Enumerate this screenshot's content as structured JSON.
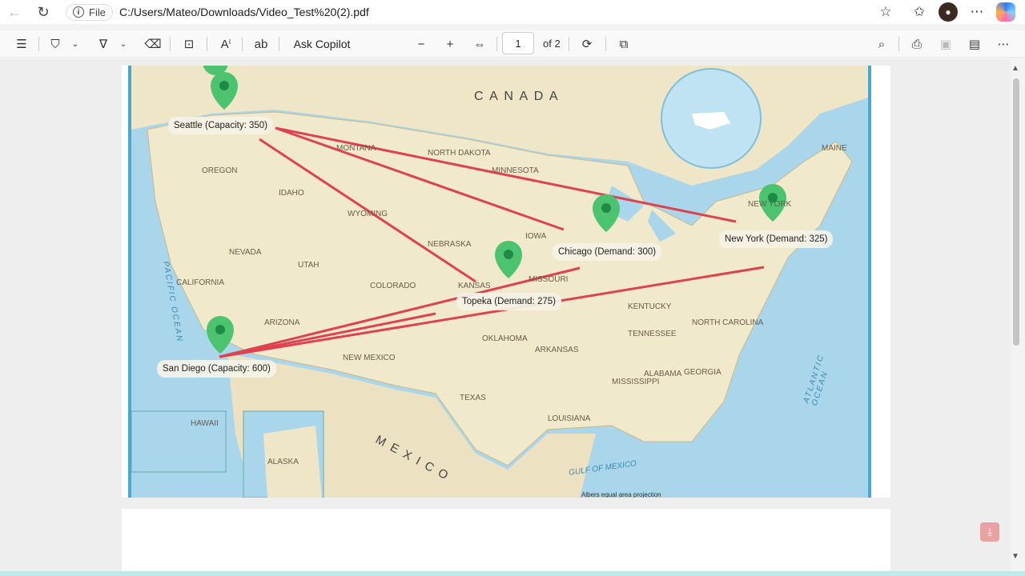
{
  "browser": {
    "file_chip": "File",
    "address": "C:/Users/Mateo/Downloads/Video_Test%20(2).pdf"
  },
  "toolbar": {
    "ask_copilot": "Ask Copilot",
    "page_current": "1",
    "page_total": "of 2"
  },
  "map": {
    "country_labels": [
      "C A N A D A",
      "M E X I C O"
    ],
    "regions": [
      "NORTH DAKOTA",
      "MINNESOTA",
      "MONTANA",
      "OREGON",
      "IDAHO",
      "WYOMING",
      "NEBRASKA",
      "IOWA",
      "NEVADA",
      "UTAH",
      "COLORADO",
      "KANSAS",
      "MISSOURI",
      "CALIFORNIA",
      "ARIZONA",
      "NEW MEXICO",
      "OKLAHOMA",
      "ARKANSAS",
      "TEXAS",
      "LOUISIANA",
      "MISSISSIPPI",
      "ALABAMA",
      "GEORGIA",
      "TENNESSEE",
      "KENTUCKY",
      "NORTH CAROLINA",
      "MAINE",
      "NEW YORK",
      "HAWAII",
      "ALASKA"
    ],
    "water_labels": [
      "GULF OF MEXICO",
      "ATLANTIC OCEAN",
      "PACIFIC OCEAN"
    ],
    "projection": "Albers equal area projection",
    "locations": [
      {
        "label": "Seattle (Capacity: 350)",
        "kind": "supply"
      },
      {
        "label": "San Diego (Capacity: 600)",
        "kind": "supply"
      },
      {
        "label": "Chicago (Demand: 300)",
        "kind": "demand"
      },
      {
        "label": "Topeka (Demand: 275)",
        "kind": "demand"
      },
      {
        "label": "New York (Demand: 325)",
        "kind": "demand"
      }
    ],
    "routes": [
      [
        "Seattle",
        "New York"
      ],
      [
        "Seattle",
        "Chicago"
      ],
      [
        "Seattle",
        "Topeka"
      ],
      [
        "San Diego",
        "New York"
      ],
      [
        "San Diego",
        "Chicago"
      ],
      [
        "San Diego",
        "Topeka"
      ]
    ],
    "colors": {
      "pin": "#4cc36f",
      "route": "#e0414f",
      "land": "#efe6c8",
      "water": "#a9d6ea"
    }
  }
}
